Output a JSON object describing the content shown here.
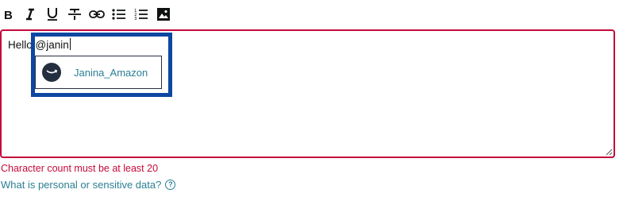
{
  "toolbar": {
    "buttons": [
      {
        "name": "bold",
        "icon": "bold-icon"
      },
      {
        "name": "italic",
        "icon": "italic-icon"
      },
      {
        "name": "underline",
        "icon": "underline-icon"
      },
      {
        "name": "strikethrough",
        "icon": "strikethrough-icon"
      },
      {
        "name": "link",
        "icon": "link-icon"
      },
      {
        "name": "bulleted-list",
        "icon": "bulleted-list-icon"
      },
      {
        "name": "numbered-list",
        "icon": "numbered-list-icon"
      },
      {
        "name": "image",
        "icon": "image-icon"
      }
    ]
  },
  "editor": {
    "value": "Hello @janin",
    "border_color": "#c40a3a"
  },
  "mention": {
    "option_label": "Janina_Amazon",
    "avatar_icon": "amazon-smile-icon",
    "highlight_color": "#0d47a1"
  },
  "validation": {
    "error": "Character count must be at least 20",
    "error_color": "#c40a3a"
  },
  "help": {
    "link_text": "What is personal or sensitive data?",
    "icon": "question-circle-icon",
    "icon_glyph": "?",
    "link_color": "#2a7f94"
  }
}
